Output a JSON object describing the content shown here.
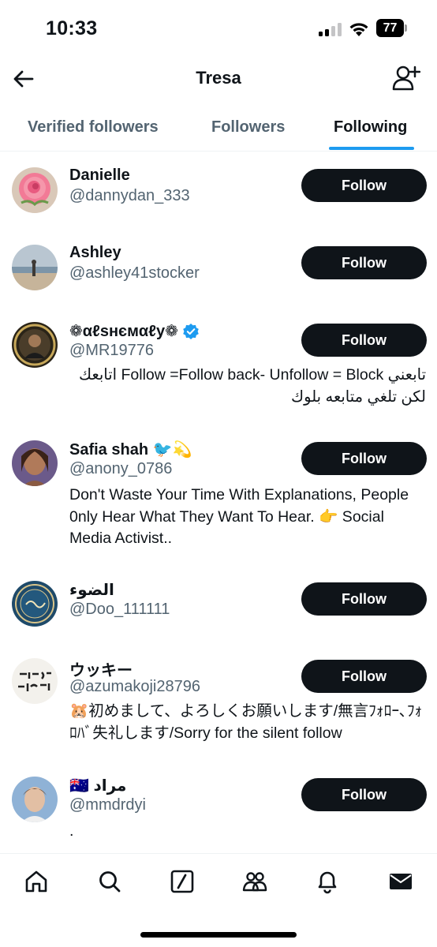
{
  "status_bar": {
    "time": "10:33",
    "battery": "77"
  },
  "header": {
    "title": "Tresa",
    "back_icon": "arrow-left-icon",
    "add_icon": "add-user-icon"
  },
  "tabs": [
    {
      "label": "Verified followers",
      "active": false
    },
    {
      "label": "Followers",
      "active": false
    },
    {
      "label": "Following",
      "active": true
    }
  ],
  "colors": {
    "accent": "#1d9bf0",
    "text": "#0f1419",
    "muted": "#536471",
    "button_bg": "#0f1419"
  },
  "users": [
    {
      "name": "Danielle",
      "handle": "@dannydan_333",
      "button": "Follow",
      "bio": ""
    },
    {
      "name": "Ashley",
      "handle": "@ashley41stocker",
      "button": "Follow",
      "bio": ""
    },
    {
      "name": "❁αℓѕнємαℓу❁",
      "handle": "@MR19776",
      "button": "Follow",
      "verified": true,
      "bio": "تابعني Follow =Follow back- Unfollow = Block اتابعك لكن تلغي متابعه بلوك"
    },
    {
      "name": "Safia shah 🐦💫",
      "handle": "@anony_0786",
      "button": "Follow",
      "bio": "Don't Waste Your Time With Explanations, People 0nly Hear What They Want To Hear. 👉 Social Media Activist.."
    },
    {
      "name": "الضوء",
      "handle": "@Doo_111111",
      "button": "Follow",
      "bio": ""
    },
    {
      "name": "ウッキー",
      "handle": "@azumakoji28796",
      "button": "Follow",
      "bio": "🐹初めまして、よろしくお願いします/無言ﾌｫﾛｰ､ﾌｫﾛﾊﾞ失礼します/Sorry for the silent follow"
    },
    {
      "name": "🇦🇺 مراد",
      "handle": "@mmdrdyi",
      "button": "Follow",
      "bio": "."
    }
  ],
  "bottom_nav": [
    "home-icon",
    "search-icon",
    "grok-icon",
    "communities-icon",
    "notifications-icon",
    "messages-icon"
  ]
}
